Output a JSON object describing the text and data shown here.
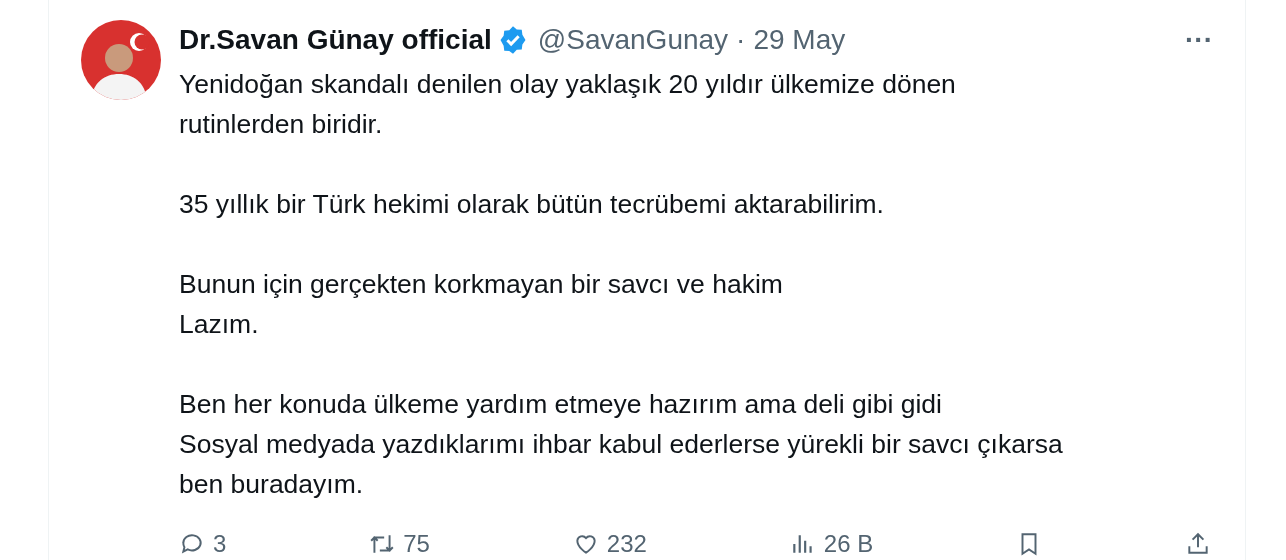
{
  "tweet": {
    "author": {
      "name": "Dr.Savan Günay official",
      "verified": true,
      "handle": "@SavanGunay",
      "separator": "·",
      "date": "29 May"
    },
    "more": "···",
    "paragraphs": [
      "Yenidoğan skandalı denilen olay yaklaşık 20 yıldır ülkemize dönen\nrutinlerden biridir.",
      "35 yıllık bir Türk hekimi olarak bütün tecrübemi aktarabilirim.",
      "Bunun için gerçekten korkmayan bir savcı ve hakim\nLazım.",
      "Ben her konuda ülkeme yardım etmeye hazırım ama deli gibi gidi\nSosyal medyada yazdıklarımı ihbar kabul ederlerse yürekli bir savcı çıkarsa\nben buradayım."
    ],
    "actions": [
      {
        "kind": "reply",
        "count": "3"
      },
      {
        "kind": "retweet",
        "count": "75"
      },
      {
        "kind": "like",
        "count": "232"
      },
      {
        "kind": "views",
        "count": "26 B"
      },
      {
        "kind": "bookmark"
      },
      {
        "kind": "share"
      }
    ]
  }
}
